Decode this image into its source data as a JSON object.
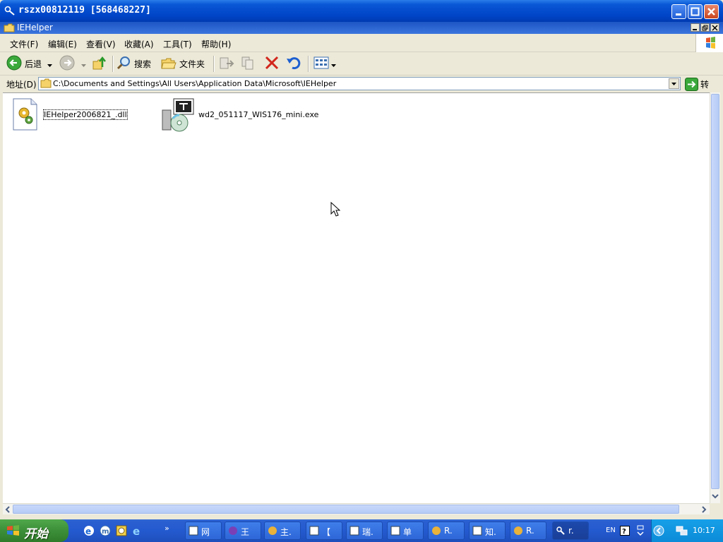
{
  "outer_window": {
    "title": "rszx00812119 [568468227]"
  },
  "explorer": {
    "title": "IEHelper",
    "menu": [
      "文件(F)",
      "编辑(E)",
      "查看(V)",
      "收藏(A)",
      "工具(T)",
      "帮助(H)"
    ],
    "toolbar": {
      "back_label": "后退",
      "search_label": "搜索",
      "folders_label": "文件夹"
    },
    "address": {
      "label": "地址(D)",
      "value": "C:\\Documents and Settings\\All Users\\Application Data\\Microsoft\\IEHelper",
      "go_label": "转"
    },
    "files": [
      {
        "name": "IEHelper2006821_.dll",
        "icon": "dll-gear-icon"
      },
      {
        "name": "wd2_051117_WIS176_mini.exe",
        "icon": "installer-cd-icon"
      }
    ]
  },
  "taskbar": {
    "start_label": "开始",
    "tasks": [
      "网",
      "王",
      "主.",
      "【",
      "瑞.",
      "单",
      "R.",
      "知.",
      "R.",
      "r."
    ],
    "language": "EN",
    "clock": "10:17"
  },
  "colors": {
    "title_blue": "#0a58d6",
    "start_green": "#3c8f38",
    "taskbar_blue": "#245ad0"
  }
}
